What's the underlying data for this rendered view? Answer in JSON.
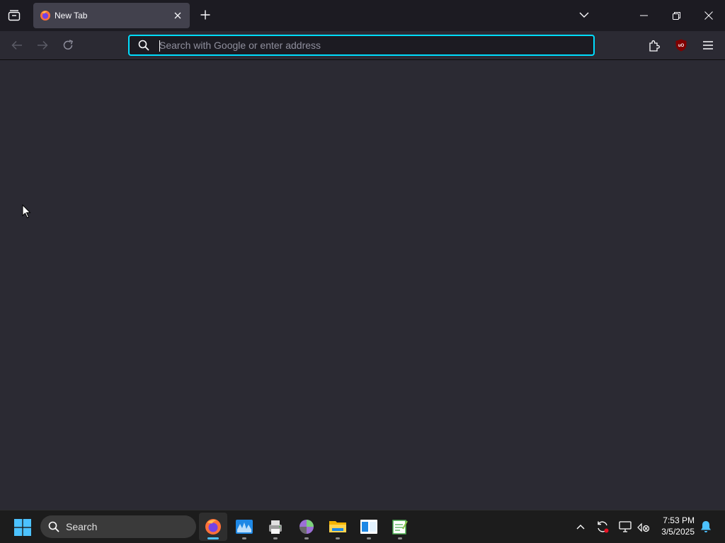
{
  "browser": {
    "tab": {
      "title": "New Tab",
      "favicon": "firefox-icon"
    },
    "urlbar": {
      "placeholder": "Search with Google or enter address",
      "value": ""
    },
    "toolbar_icons": [
      "tab-overview-icon",
      "new-tab-icon",
      "list-all-tabs-icon",
      "back-icon",
      "forward-icon",
      "reload-icon",
      "search-icon",
      "extensions-icon",
      "ublock-origin-icon",
      "menu-icon"
    ],
    "window_controls": [
      "minimize-icon",
      "restore-icon",
      "close-icon"
    ]
  },
  "taskbar": {
    "search_label": "Search",
    "apps": [
      "firefox-icon",
      "audio-app-icon",
      "printer-app-icon",
      "orb-app-icon",
      "file-explorer-icon",
      "store-app-icon",
      "notepad-app-icon"
    ],
    "tray": [
      "chevron-up-icon",
      "sync-icon",
      "display-icon",
      "network-disconnected-icon"
    ],
    "time": "7:53 PM",
    "date": "3/5/2025"
  },
  "colors": {
    "chrome_bg": "#1c1b22",
    "toolbar_bg": "#2b2a33",
    "tab_bg": "#42414d",
    "focus_ring": "#00ddff",
    "taskbar_bg": "#1c1c1c",
    "accent": "#4cc2ff"
  }
}
